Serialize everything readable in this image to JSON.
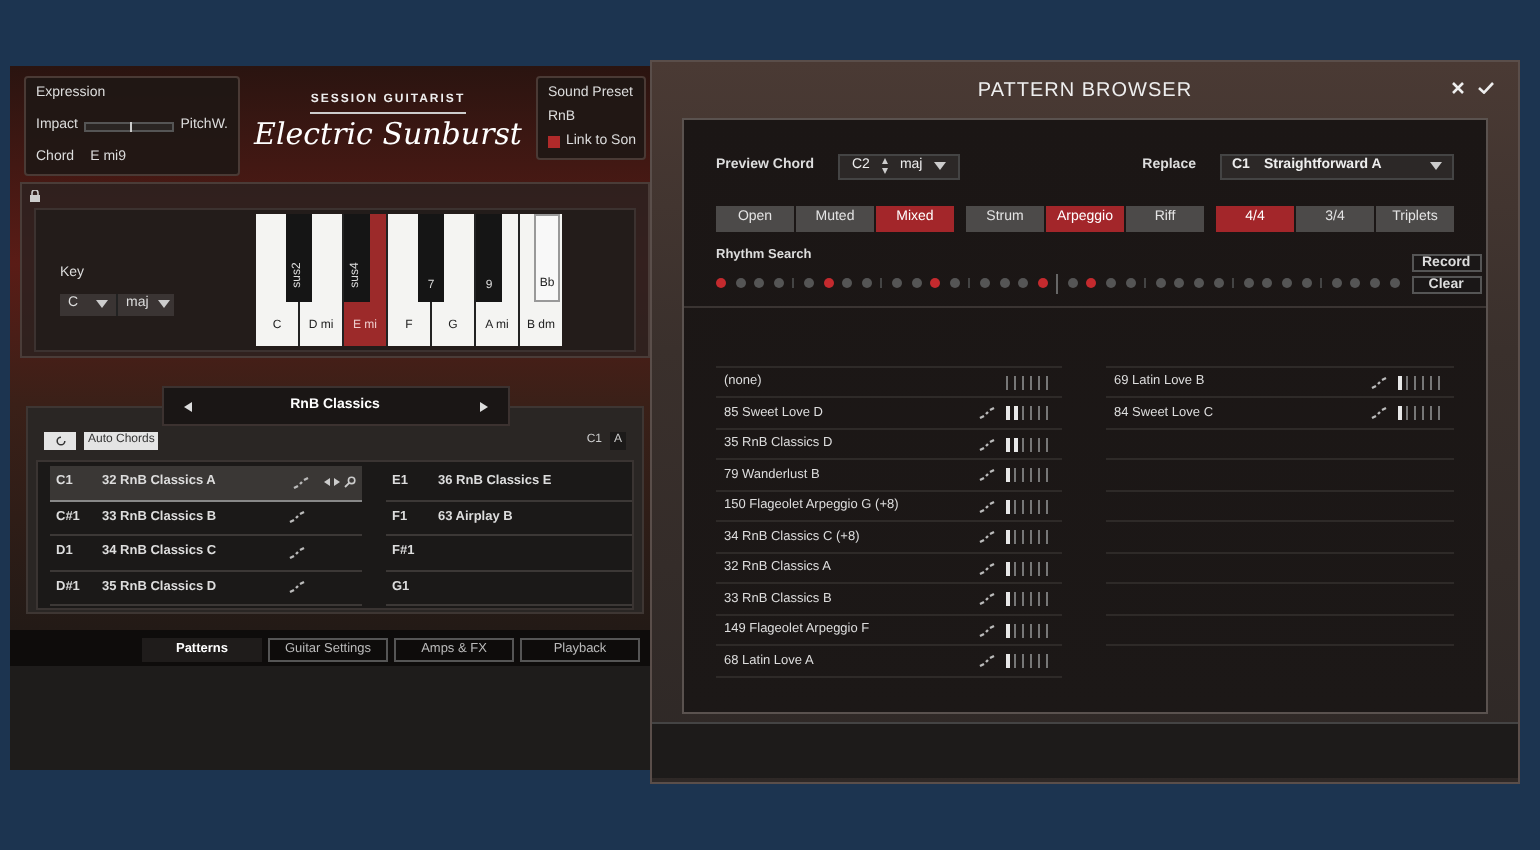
{
  "expression": {
    "title": "Expression",
    "impact_label": "Impact",
    "pitch_label": "PitchW.",
    "slider": {
      "level": 0.5
    },
    "chord_label": "Chord",
    "chord_value": "E mi9"
  },
  "logo": {
    "subtitle": "SESSION GUITARIST",
    "title": "Electric Sunburst"
  },
  "sound_preset": {
    "title": "Sound Preset",
    "value": "RnB",
    "link_label": "Link to Son",
    "link_checked": true
  },
  "key_selector": {
    "label": "Key",
    "root": "C",
    "mode": "maj"
  },
  "keyboard": {
    "white_keys": [
      {
        "label": "C",
        "selected": false
      },
      {
        "label": "D mi",
        "selected": false
      },
      {
        "label": "E mi",
        "selected": true
      },
      {
        "label": "F",
        "selected": false
      },
      {
        "label": "G",
        "selected": false
      },
      {
        "label": "A mi",
        "selected": false
      },
      {
        "label": "B dm",
        "selected": false
      }
    ],
    "black_keys": [
      {
        "label": "sus2",
        "vertical": true,
        "selected": false
      },
      {
        "label": "sus4",
        "vertical": true,
        "selected": false
      },
      {
        "label": "7",
        "vertical": false,
        "selected": false
      },
      {
        "label": "9",
        "vertical": false,
        "selected": false
      },
      {
        "label": "Bb",
        "vertical": false,
        "selected": true
      }
    ]
  },
  "pattern_set": {
    "title": "RnB Classics"
  },
  "auto_chords": "Auto Chords",
  "slot_header": [
    "C1",
    "A"
  ],
  "slots_left": [
    {
      "key": "C1",
      "number": "32",
      "name": "RnB Classics A",
      "selected": true
    },
    {
      "key": "C#1",
      "number": "33",
      "name": "RnB Classics B",
      "selected": false
    },
    {
      "key": "D1",
      "number": "34",
      "name": "RnB Classics C",
      "selected": false
    },
    {
      "key": "D#1",
      "number": "35",
      "name": "RnB Classics D",
      "selected": false
    }
  ],
  "slots_right": [
    {
      "key": "E1",
      "number": "36",
      "name": "RnB Classics E"
    },
    {
      "key": "F1",
      "number": "63",
      "name": "Airplay B"
    },
    {
      "key": "F#1"
    },
    {
      "key": "G1"
    }
  ],
  "tabs": [
    {
      "label": "Patterns",
      "selected": true
    },
    {
      "label": "Guitar Settings",
      "selected": false
    },
    {
      "label": "Amps & FX",
      "selected": false
    },
    {
      "label": "Playback",
      "selected": false
    }
  ],
  "browser": {
    "title": "PATTERN BROWSER",
    "preview_label": "Preview Chord",
    "preview_root": "C2",
    "preview_mode": "maj",
    "replace_label": "Replace",
    "replace_key": "C1",
    "replace_value": "Straightforward A",
    "filter_groups": [
      [
        {
          "label": "Open",
          "selected": false
        },
        {
          "label": "Muted",
          "selected": false
        },
        {
          "label": "Mixed",
          "selected": true
        }
      ],
      [
        {
          "label": "Strum",
          "selected": false
        },
        {
          "label": "Arpeggio",
          "selected": true
        },
        {
          "label": "Riff",
          "selected": false
        }
      ],
      [
        {
          "label": "4/4",
          "selected": true
        },
        {
          "label": "3/4",
          "selected": false
        },
        {
          "label": "Triplets",
          "selected": false
        }
      ]
    ],
    "rhythm_label": "Rhythm Search",
    "steps": [
      true,
      false,
      false,
      false,
      false,
      true,
      false,
      false,
      false,
      false,
      true,
      false,
      false,
      false,
      false,
      true,
      false,
      true,
      false,
      false,
      false,
      false,
      false,
      false,
      false,
      false,
      false,
      false,
      false,
      false,
      false,
      false
    ],
    "record": "Record",
    "clear": "Clear",
    "results_left": [
      {
        "name": "(none)"
      },
      {
        "number": "85",
        "name": "Sweet Love D",
        "level": 0.33
      },
      {
        "number": "35",
        "name": "RnB Classics D",
        "level": 0.33
      },
      {
        "number": "79",
        "name": "Wanderlust B",
        "level": 0.17
      },
      {
        "number": "150",
        "name": "Flageolet Arpeggio G (+8)",
        "level": 0.17
      },
      {
        "number": "34",
        "name": "RnB Classics C (+8)",
        "level": 0.17
      },
      {
        "number": "32",
        "name": "RnB Classics A",
        "level": 0.17
      },
      {
        "number": "33",
        "name": "RnB Classics B",
        "level": 0.17
      },
      {
        "number": "149",
        "name": "Flageolet Arpeggio F",
        "level": 0.17
      },
      {
        "number": "68",
        "name": "Latin Love A",
        "level": 0.17
      }
    ],
    "results_right": [
      {
        "number": "69",
        "name": "Latin Love B",
        "level": 0.17
      },
      {
        "number": "84",
        "name": "Sweet Love C",
        "level": 0.17
      }
    ]
  }
}
